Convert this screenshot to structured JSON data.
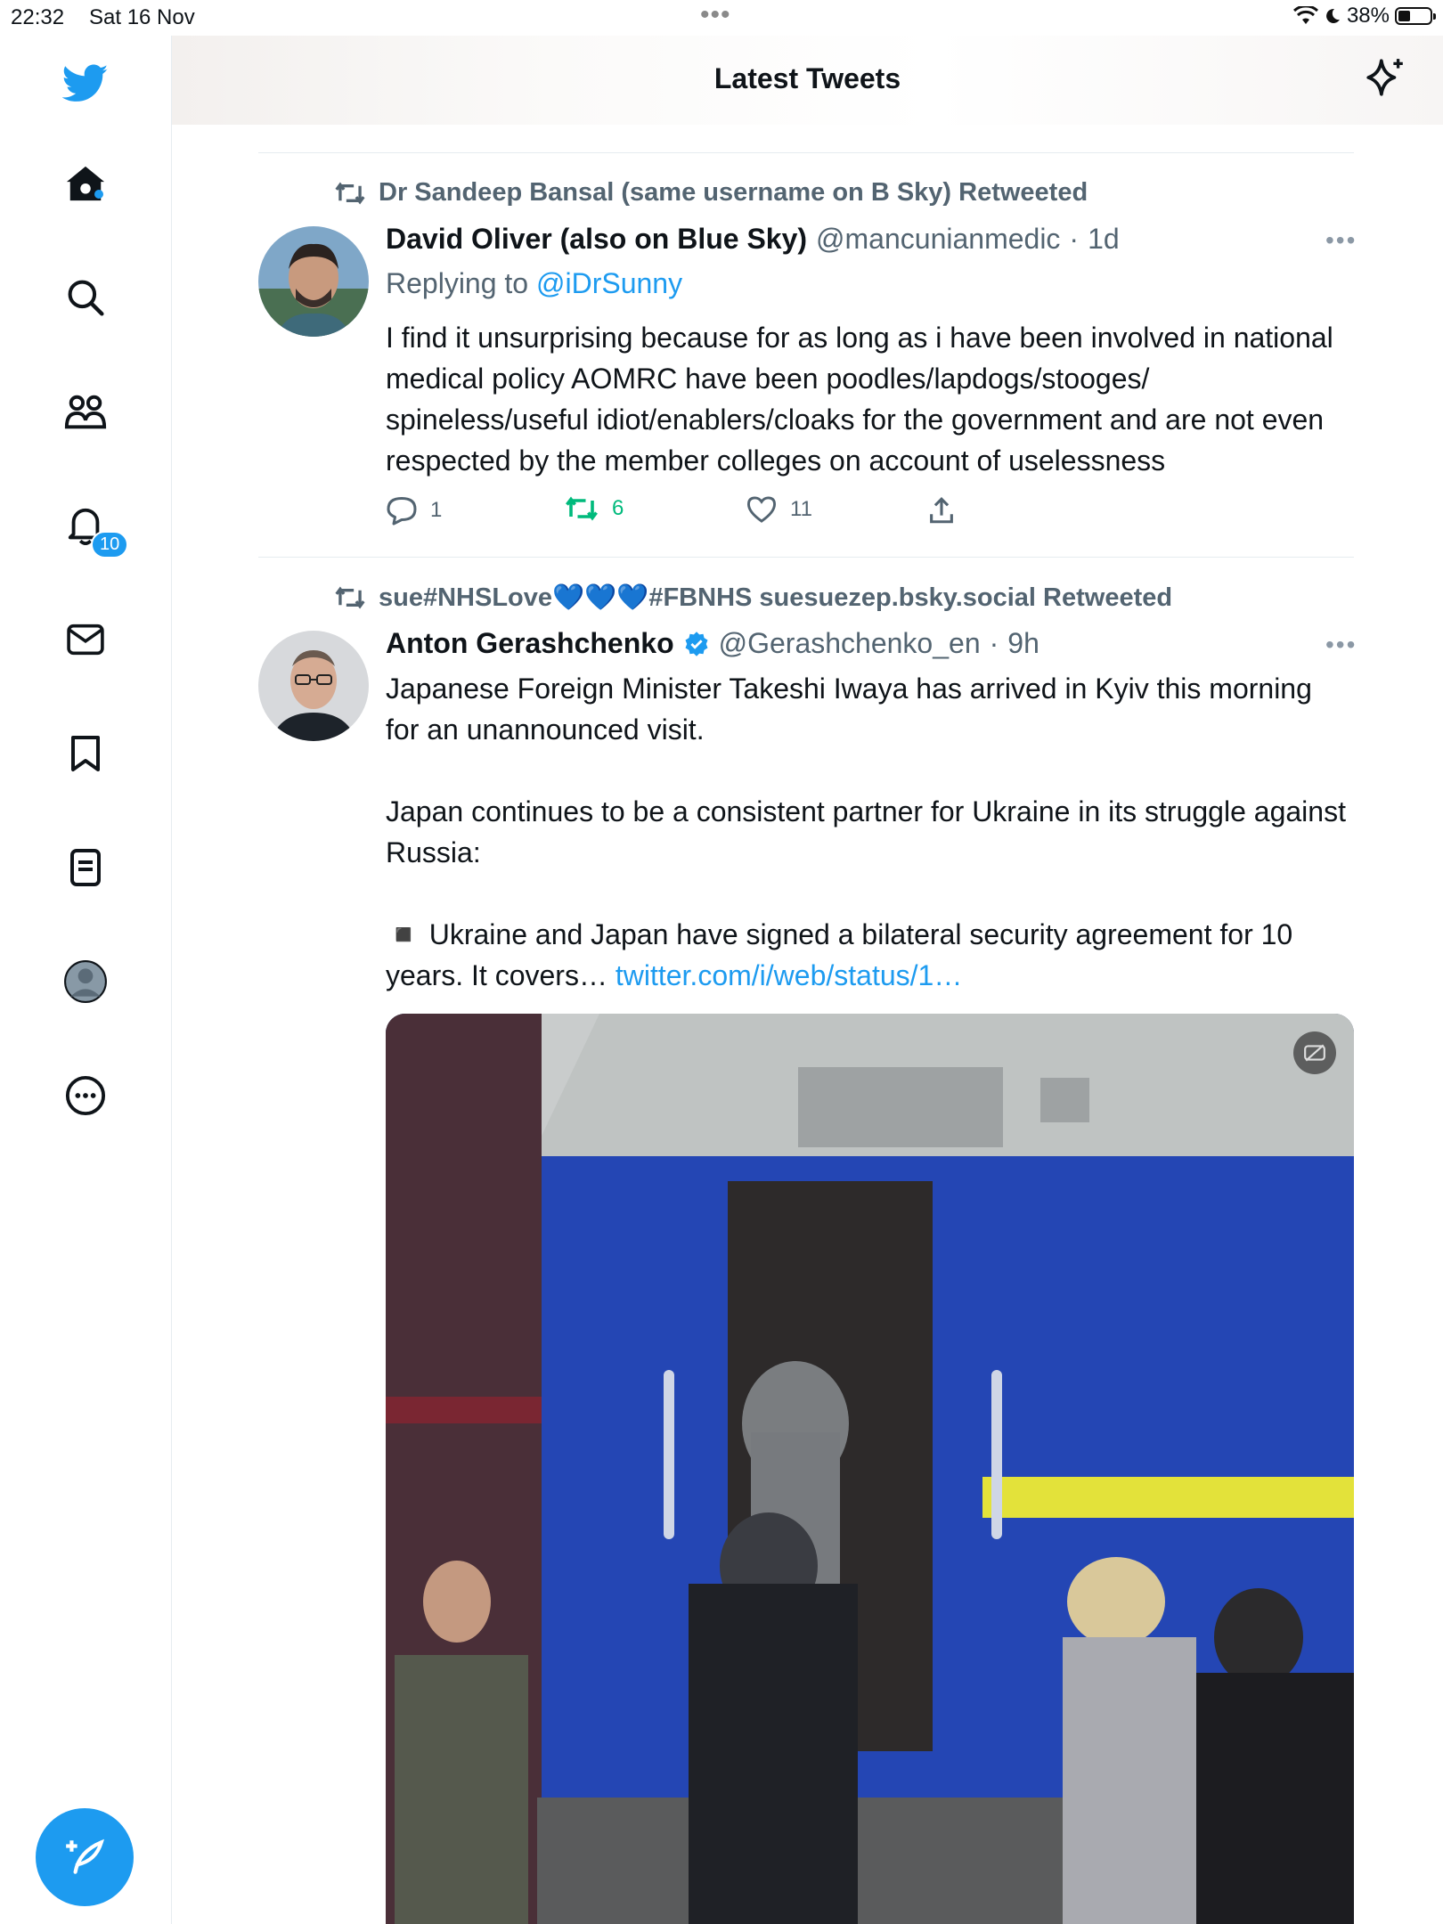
{
  "status_bar": {
    "time": "22:32",
    "date": "Sat 16 Nov",
    "battery": "38%",
    "battery_level": 0.38
  },
  "header": {
    "title": "Latest Tweets"
  },
  "sidebar": {
    "notifications_badge": "10"
  },
  "tweets": [
    {
      "retweeted_by": "Dr Sandeep Bansal (same username on B Sky) Retweeted",
      "name": "David Oliver (also on Blue Sky)",
      "handle": "@mancunianmedic",
      "sep": "·",
      "time": "1d",
      "replying_prefix": "Replying to",
      "replying_to": "@iDrSunny",
      "text": "I find it unsurprising because for as long as i have been involved in national medical policy AOMRC have been poodles/lapdogs/stooges/ spineless/useful idiot/enablers/cloaks for the government and are not even respected by the member colleges on account of uselessness",
      "replies": "1",
      "retweets": "6",
      "likes": "11"
    },
    {
      "retweeted_by": "sue#NHSLove💙💙💙#FBNHS suesuezep.bsky.social Retweeted",
      "name": "Anton Gerashchenko",
      "verified": true,
      "handle": "@Gerashchenko_en",
      "sep": "·",
      "time": "9h",
      "text_p1": "Japanese Foreign Minister Takeshi Iwaya has arrived in Kyiv this morning for an unannounced visit.",
      "text_p2": "Japan continues to be a consistent partner for Ukraine in its struggle against Russia:",
      "text_p3": "◾️ Ukraine and Japan have signed a bilateral security agreement for 10 years. It covers…",
      "link": "twitter.com/i/web/status/1…"
    }
  ],
  "colors": {
    "accent": "#1d9bf0",
    "retweet_green": "#00ba7c",
    "secondary_text": "#536471"
  }
}
